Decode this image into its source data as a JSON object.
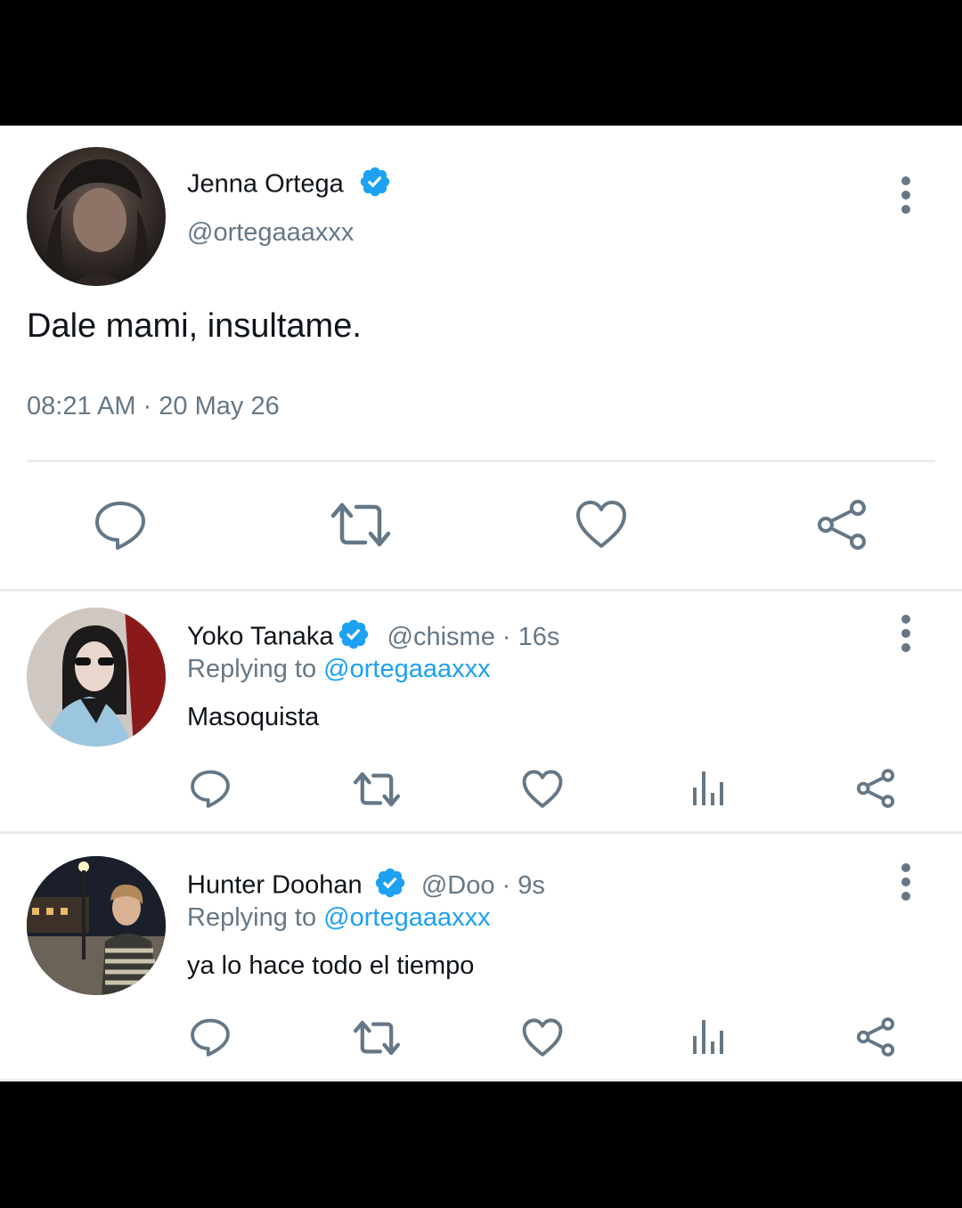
{
  "colors": {
    "verified_blue": "#1da1f2",
    "muted_gray": "#657786",
    "text_dark": "#0f1419",
    "icon_gray": "#657786"
  },
  "main_tweet": {
    "display_name": "Jenna Ortega",
    "handle": "@ortegaaaxxx",
    "text": "Dale mami, insultame.",
    "timestamp": "08:21 AM · 20 May 26",
    "avatar": "portrait photo of woman in black beanie",
    "actions": [
      "reply-icon",
      "retweet-icon",
      "like-icon",
      "share-icon"
    ]
  },
  "replies": [
    {
      "display_name": "Yoko Tanaka",
      "meta": "@chisme · 16s",
      "replying_prefix": "Replying to",
      "replying_handle": "@ortegaaaxxx",
      "text": "Masoquista",
      "avatar": "photo of woman with sunglasses",
      "actions": [
        "reply-icon",
        "retweet-icon",
        "like-icon",
        "analytics-icon",
        "share-icon"
      ]
    },
    {
      "display_name": "Hunter Doohan",
      "meta": "@Doo · 9s",
      "replying_prefix": "Replying to",
      "replying_handle": "@ortegaaaxxx",
      "text": "ya lo hace todo el tiempo",
      "avatar": "night photo of man in striped shirt",
      "actions": [
        "reply-icon",
        "retweet-icon",
        "like-icon",
        "analytics-icon",
        "share-icon"
      ]
    }
  ]
}
